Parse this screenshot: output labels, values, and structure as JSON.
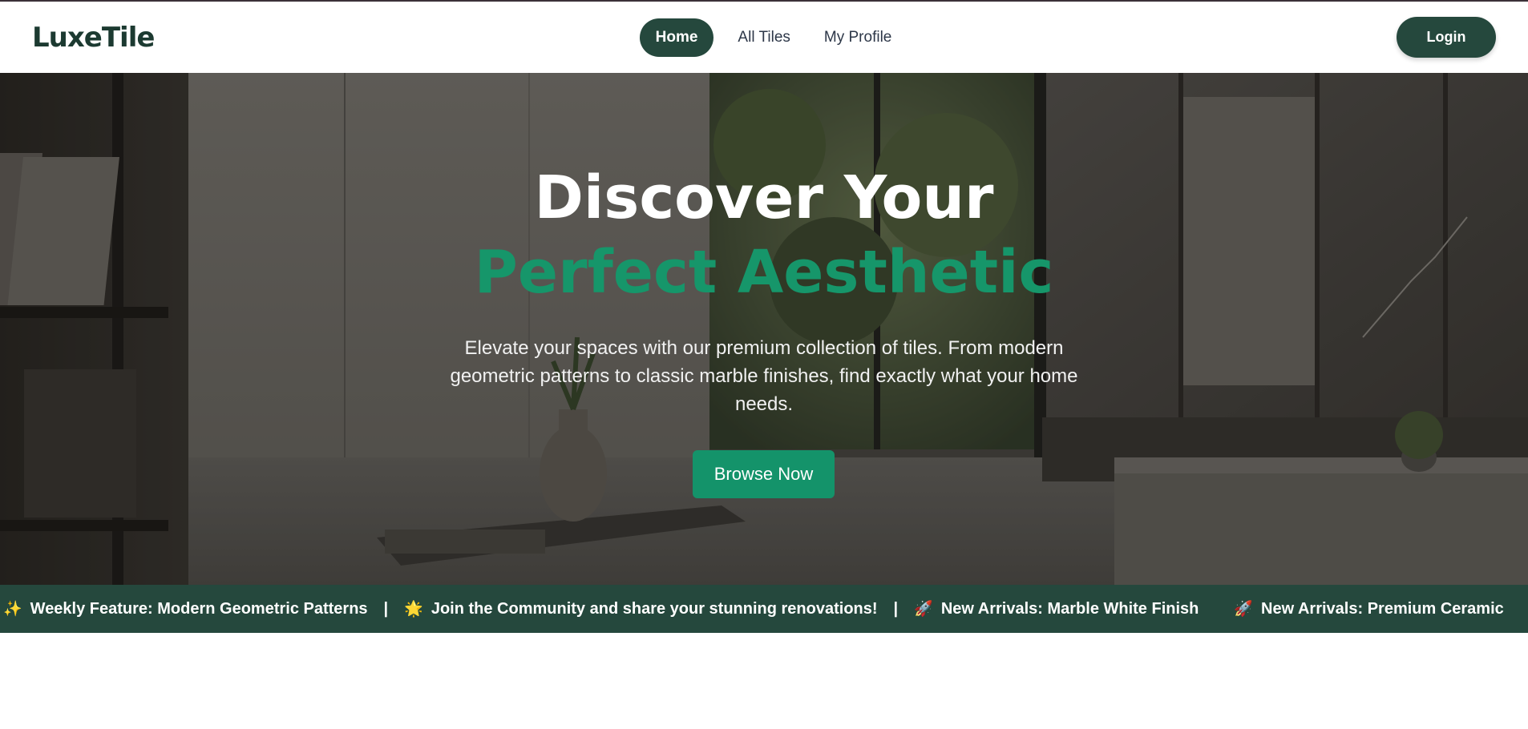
{
  "nav": {
    "logo": "LuxeTile",
    "links": [
      {
        "label": "Home",
        "active": true
      },
      {
        "label": "All Tiles",
        "active": false
      },
      {
        "label": "My Profile",
        "active": false
      }
    ],
    "login_label": "Login"
  },
  "hero": {
    "title_line1": "Discover Your",
    "title_line2": "Perfect Aesthetic",
    "subtitle": "Elevate your spaces with our premium collection of tiles. From modern geometric patterns to classic marble finishes, find exactly what your home needs.",
    "cta_label": "Browse Now"
  },
  "ticker": {
    "segments": [
      {
        "emoji": "✨",
        "text": "Weekly Feature: Modern Geometric Patterns"
      },
      {
        "emoji": "🌟",
        "text": "Join the Community and share your stunning renovations!"
      },
      {
        "emoji": "🚀",
        "text": "New Arrivals: Marble White Finish"
      }
    ],
    "next_item": {
      "emoji": "🚀",
      "text": "New Arrivals: Premium Ceramic"
    },
    "separator": "|"
  },
  "colors": {
    "brand_dark": "#25483d",
    "brand_green": "#16966a",
    "logo": "#1c3a31"
  }
}
